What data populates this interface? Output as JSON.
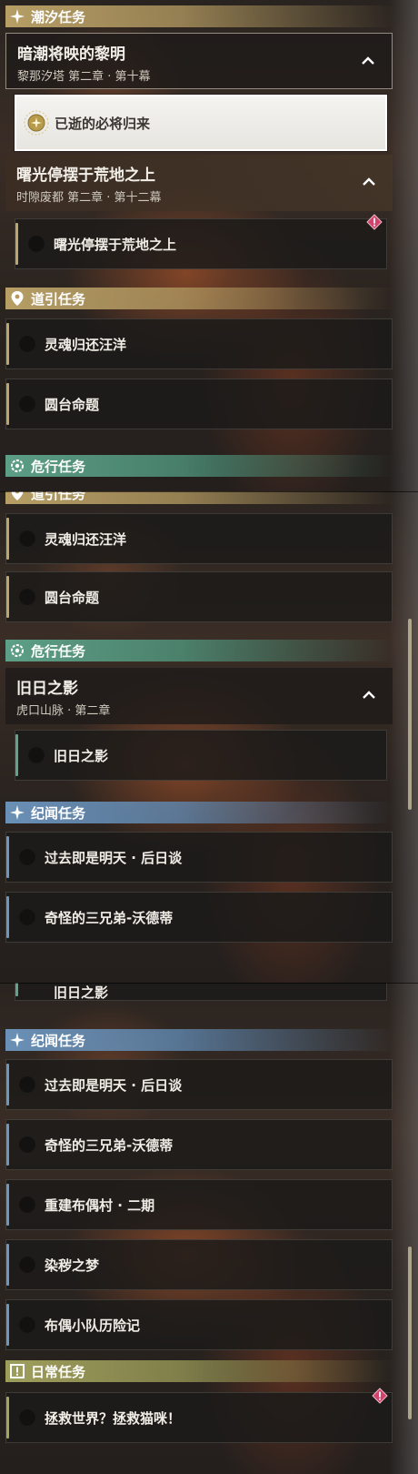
{
  "colors": {
    "tide_accent": "#BEA569",
    "guide_accent": "#BEA569",
    "danger_accent": "#5FA58C",
    "lore_accent": "#6E96BE",
    "daily_accent": "#A5A55F",
    "alert": "#D2436B"
  },
  "categories": {
    "tide": {
      "label": "潮汐任务",
      "icon": "sparkle-icon"
    },
    "guide": {
      "label": "道引任务",
      "icon": "map-pin-icon"
    },
    "danger": {
      "label": "危行任务",
      "icon": "gear-eye-icon"
    },
    "lore": {
      "label": "纪闻任务",
      "icon": "sparkle-icon"
    },
    "daily": {
      "label": "日常任务",
      "icon": "exclamation-box-icon"
    }
  },
  "chapters": {
    "dawn": {
      "title": "暗潮将映的黎明",
      "subtitle": "黎那汐塔 第二章 · 第十幕"
    },
    "dawnlight": {
      "title": "曙光停摆于荒地之上",
      "subtitle": "时隙废都 第二章 · 第十二幕"
    },
    "oldshadow": {
      "title": "旧日之影",
      "subtitle": "虎口山脉 · 第二章"
    }
  },
  "quests": {
    "returned": "已逝的必将归来",
    "dawnlight_quest": "曙光停摆于荒地之上",
    "soul": "灵魂归还汪洋",
    "round": "圆台命题",
    "oldshadow_quest": "旧日之影",
    "past": "过去即是明天 · 后日谈",
    "brothers": "奇怪的三兄弟-沃德蒂",
    "village": "重建布偶村 · 二期",
    "dream": "染秽之梦",
    "squad": "布偶小队历险记",
    "save": "拯救世界？拯救猫咪！"
  },
  "fragments": {
    "danger_cut": "危行任务",
    "oldshadow_cut": "旧日之影"
  }
}
